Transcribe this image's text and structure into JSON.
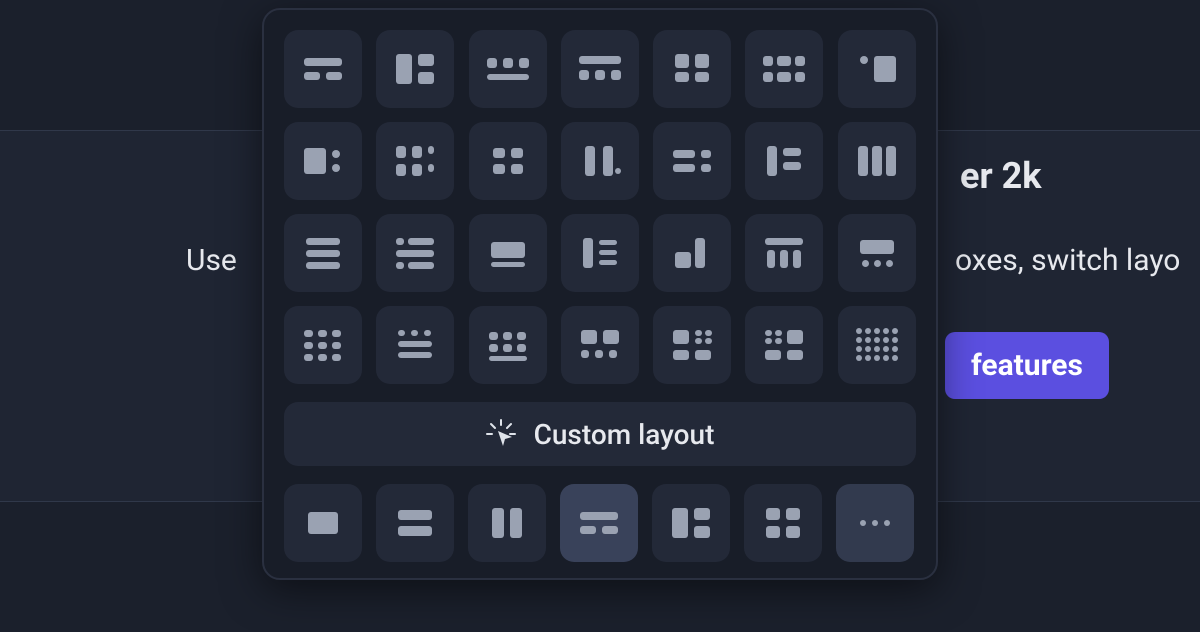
{
  "background": {
    "title_fragment_right": "er 2k",
    "lead_fragment_left": "Use",
    "lead_fragment_right": "oxes, switch layo",
    "cta_label": "features"
  },
  "popover": {
    "custom_layout_label": "Custom layout",
    "layout_tiles": [
      {
        "name": "layout-1-1"
      },
      {
        "name": "layout-1-2"
      },
      {
        "name": "layout-1-3"
      },
      {
        "name": "layout-1-4"
      },
      {
        "name": "layout-1-5"
      },
      {
        "name": "layout-1-6"
      },
      {
        "name": "layout-1-7"
      },
      {
        "name": "layout-2-1"
      },
      {
        "name": "layout-2-2"
      },
      {
        "name": "layout-2-3"
      },
      {
        "name": "layout-2-4"
      },
      {
        "name": "layout-2-5"
      },
      {
        "name": "layout-2-6"
      },
      {
        "name": "layout-2-7"
      },
      {
        "name": "layout-3-1"
      },
      {
        "name": "layout-3-2"
      },
      {
        "name": "layout-3-3"
      },
      {
        "name": "layout-3-4"
      },
      {
        "name": "layout-3-5"
      },
      {
        "name": "layout-3-6"
      },
      {
        "name": "layout-3-7"
      },
      {
        "name": "layout-4-1"
      },
      {
        "name": "layout-4-2"
      },
      {
        "name": "layout-4-3"
      },
      {
        "name": "layout-4-4"
      },
      {
        "name": "layout-4-5"
      },
      {
        "name": "layout-4-6"
      },
      {
        "name": "layout-4-7"
      }
    ]
  },
  "dock": {
    "items": [
      {
        "name": "dock-layout-1"
      },
      {
        "name": "dock-layout-2"
      },
      {
        "name": "dock-layout-3"
      },
      {
        "name": "dock-layout-4"
      },
      {
        "name": "dock-layout-5"
      },
      {
        "name": "dock-layout-6"
      },
      {
        "name": "dock-more"
      }
    ]
  },
  "colors": {
    "bg": "#1b202c",
    "panel": "#1f2533",
    "tile": "#232938",
    "icon": "#9aa2b2",
    "accent": "#5b4fe0"
  }
}
